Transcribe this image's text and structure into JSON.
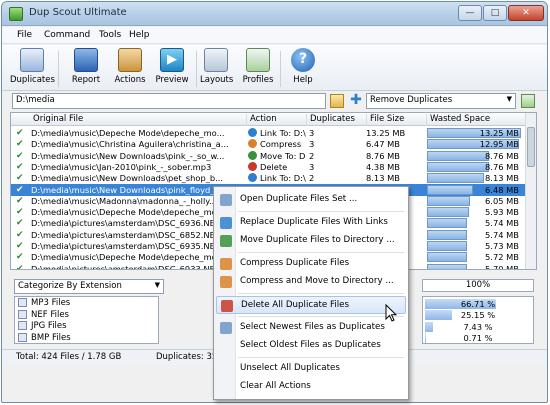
{
  "window": {
    "title": "Dup Scout Ultimate",
    "minimize": "—",
    "maximize": "□",
    "close": "✕"
  },
  "menu": [
    "File",
    "Command",
    "Tools",
    "Help"
  ],
  "toolbar": {
    "duplicates": "Duplicates",
    "report": "Report",
    "actions": "Actions",
    "preview": "Preview",
    "layouts": "Layouts",
    "profiles": "Profiles",
    "help": "Help"
  },
  "path": {
    "value": "D:\\media"
  },
  "action_select": "Remove Duplicates",
  "columns": {
    "original_file": "Original File",
    "action": "Action",
    "duplicates": "Duplicates",
    "file_size": "File Size",
    "wasted_space": "Wasted Space"
  },
  "rows": [
    {
      "file": "D:\\media\\music\\Depeche Mode\\depeche_mo...",
      "action": "Link To: D:\\...",
      "dup": "3",
      "size": "13.25 MB",
      "wasted": "13.25 MB",
      "frac": 1.0,
      "color": "#2f7fd0"
    },
    {
      "file": "D:\\media\\music\\Christina Aguilera\\christina_a...",
      "action": "Compress",
      "dup": "3",
      "size": "6.47 MB",
      "wasted": "12.95 MB",
      "frac": 0.98,
      "color": "#d9822b"
    },
    {
      "file": "D:\\media\\music\\New Downloads\\pink_-_so_w...",
      "action": "Move To: D:...",
      "dup": "2",
      "size": "8.76 MB",
      "wasted": "8.76 MB",
      "frac": 0.66,
      "color": "#3b8f3b"
    },
    {
      "file": "D:\\media\\music\\Jan-2010\\pink_-_sober.mp3",
      "action": "Delete",
      "dup": "3",
      "size": "4.38 MB",
      "wasted": "8.76 MB",
      "frac": 0.66,
      "color": "#c83a2a"
    },
    {
      "file": "D:\\media\\music\\New Downloads\\pet_shop_b...",
      "action": "Link To: D:\\...",
      "dup": "2",
      "size": "8.13 MB",
      "wasted": "8.13 MB",
      "frac": 0.61,
      "color": "#2f7fd0"
    },
    {
      "file": "D:\\media\\music\\New Downloads\\pink_floyd_...",
      "action": "",
      "dup": "",
      "size": "",
      "wasted": "6.48 MB",
      "frac": 0.49,
      "color": ""
    },
    {
      "file": "D:\\media\\music\\Madonna\\madonna_-_holly...",
      "action": "",
      "dup": "",
      "size": "",
      "wasted": "6.05 MB",
      "frac": 0.46,
      "color": ""
    },
    {
      "file": "D:\\media\\music\\Depeche Mode\\depeche_mo...",
      "action": "",
      "dup": "",
      "size": "",
      "wasted": "5.93 MB",
      "frac": 0.45,
      "color": ""
    },
    {
      "file": "D:\\media\\pictures\\amsterdam\\DSC_6936.NEF",
      "action": "",
      "dup": "",
      "size": "",
      "wasted": "5.74 MB",
      "frac": 0.43,
      "color": ""
    },
    {
      "file": "D:\\media\\pictures\\amsterdam\\DSC_6852.NEF",
      "action": "",
      "dup": "",
      "size": "",
      "wasted": "5.74 MB",
      "frac": 0.43,
      "color": ""
    },
    {
      "file": "D:\\media\\pictures\\amsterdam\\DSC_6935.NEF",
      "action": "",
      "dup": "",
      "size": "",
      "wasted": "5.73 MB",
      "frac": 0.43,
      "color": ""
    },
    {
      "file": "D:\\media\\music\\Depeche Mode\\depeche_mo...",
      "action": "",
      "dup": "",
      "size": "",
      "wasted": "5.72 MB",
      "frac": 0.43,
      "color": ""
    },
    {
      "file": "D:\\media\\pictures\\amsterdam\\DSC_6933.NEF",
      "action": "",
      "dup": "",
      "size": "",
      "wasted": "5.70 MB",
      "frac": 0.43,
      "color": ""
    }
  ],
  "category": {
    "select": "Categorize By Extension",
    "progress": "100%"
  },
  "categories": [
    {
      "name": "MP3 Files",
      "pct": "66.71 %",
      "frac": 0.667
    },
    {
      "name": "NEF Files",
      "pct": "25.15 %",
      "frac": 0.2515
    },
    {
      "name": "JPG Files",
      "pct": "7.43 %",
      "frac": 0.0743
    },
    {
      "name": "BMP Files",
      "pct": "0.71 %",
      "frac": 0.0071
    }
  ],
  "status": {
    "total": "Total: 424 Files / 1.78 GB",
    "duplicates": "Duplicates: 35"
  },
  "context_menu": [
    {
      "label": "Open Duplicate Files Set ...",
      "sep_after": true,
      "color": "#6f95c6"
    },
    {
      "label": "Replace Duplicate Files With Links",
      "sep_after": false,
      "color": "#2f7fd0"
    },
    {
      "label": "Move Duplicate Files to Directory ...",
      "sep_after": true,
      "color": "#3b8f3b"
    },
    {
      "label": "Compress Duplicate Files",
      "sep_after": false,
      "color": "#d9822b"
    },
    {
      "label": "Compress and Move to Directory ...",
      "sep_after": true,
      "color": "#d9822b"
    },
    {
      "label": "Delete All Duplicate Files",
      "sep_after": true,
      "color": "#c83a2a",
      "hover": true
    },
    {
      "label": "Select Newest Files as Duplicates",
      "sep_after": false,
      "color": "#6f95c6"
    },
    {
      "label": "Select Oldest Files as Duplicates",
      "sep_after": true,
      "color": ""
    },
    {
      "label": "Unselect All Duplicates",
      "sep_after": false,
      "color": ""
    },
    {
      "label": "Clear All Actions",
      "sep_after": false,
      "color": ""
    }
  ]
}
